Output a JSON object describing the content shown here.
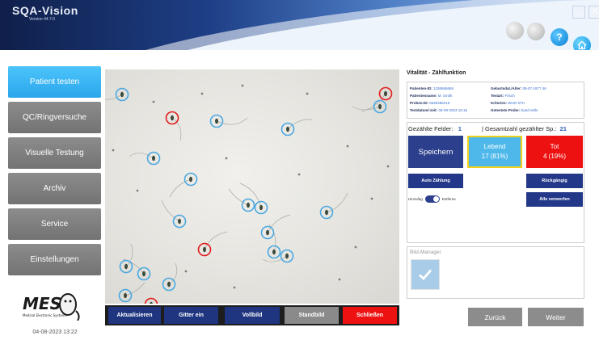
{
  "header": {
    "app_name": "SQA-Vision",
    "version": "Version 44.7.0",
    "minimize_glyph": "_",
    "close_glyph": "X",
    "help_glyph": "?",
    "icons": [
      "circle-grey-icon",
      "circle-grey-icon",
      "help-icon",
      "home-icon"
    ]
  },
  "sidebar": {
    "items": [
      {
        "label": "Patient testen",
        "active": true
      },
      {
        "label": "QC/Ringversuche",
        "active": false
      },
      {
        "label": "Visuelle Testung",
        "active": false
      },
      {
        "label": "Archiv",
        "active": false
      },
      {
        "label": "Service",
        "active": false
      },
      {
        "label": "Einstellungen",
        "active": false
      }
    ],
    "logo_text": "MES",
    "logo_subtext": "Medical Electronic Systems",
    "datetime": "04-08-2023 13:22"
  },
  "toolbar": {
    "refresh": "Aktualisieren",
    "grid": "Gitter ein",
    "fullscreen": "Vollbild",
    "still": "Standbild",
    "close": "Schließen"
  },
  "panel": {
    "title": "Vitalität - Zählfunktion",
    "info": {
      "patient_id_label": "Patienten-ID:",
      "patient_id": "1236666669",
      "dob_label": "Geburtsdat./Alter:",
      "dob": "08-07-1977 46",
      "patient_name_label": "Patientenname:",
      "patient_name": "M. Smith",
      "test_type_label": "Testart:",
      "test_type": "Frisch",
      "sample_id_label": "Proben-ID:",
      "sample_id": "6645486216",
      "criteria_label": "Kriterien:",
      "criteria": "WHO 6TH",
      "test_datetime_label": "Testdatum/-zeit:",
      "test_datetime": "05-08-2023 15:16",
      "tested_sample_label": "Getestete Probe:",
      "tested_sample": "Sand-sells"
    },
    "counted_fields_label": "Gezählte Felder:",
    "counted_fields": "1",
    "total_label": "| Gesamtzahl gezählter Sp.:",
    "total": "21",
    "save": "Speichern",
    "alive_label": "Lebend",
    "alive_value": "17 (81%)",
    "dead_label": "Tot",
    "dead_value": "4 (19%)",
    "auto_count": "Auto Zählung",
    "undo": "Rückgängig",
    "toggle_left": "Hinzufüg",
    "toggle_right": "Entferne",
    "discard_all": "Alle verwerfen",
    "image_manager": "Bild-Manager",
    "back": "Zurück",
    "next": "Weiter"
  },
  "micro_image": {
    "alive_count": 17,
    "dead_count": 4,
    "alive_color": "#4aa8e0",
    "dead_color": "#e11b1b"
  },
  "colors": {
    "active_sidebar": "#35b2f2",
    "sidebar": "#808080",
    "navy": "#24388a",
    "red": "#ee1111",
    "alive_fill": "#4fb8ea",
    "alive_border": "#f1d21a"
  }
}
